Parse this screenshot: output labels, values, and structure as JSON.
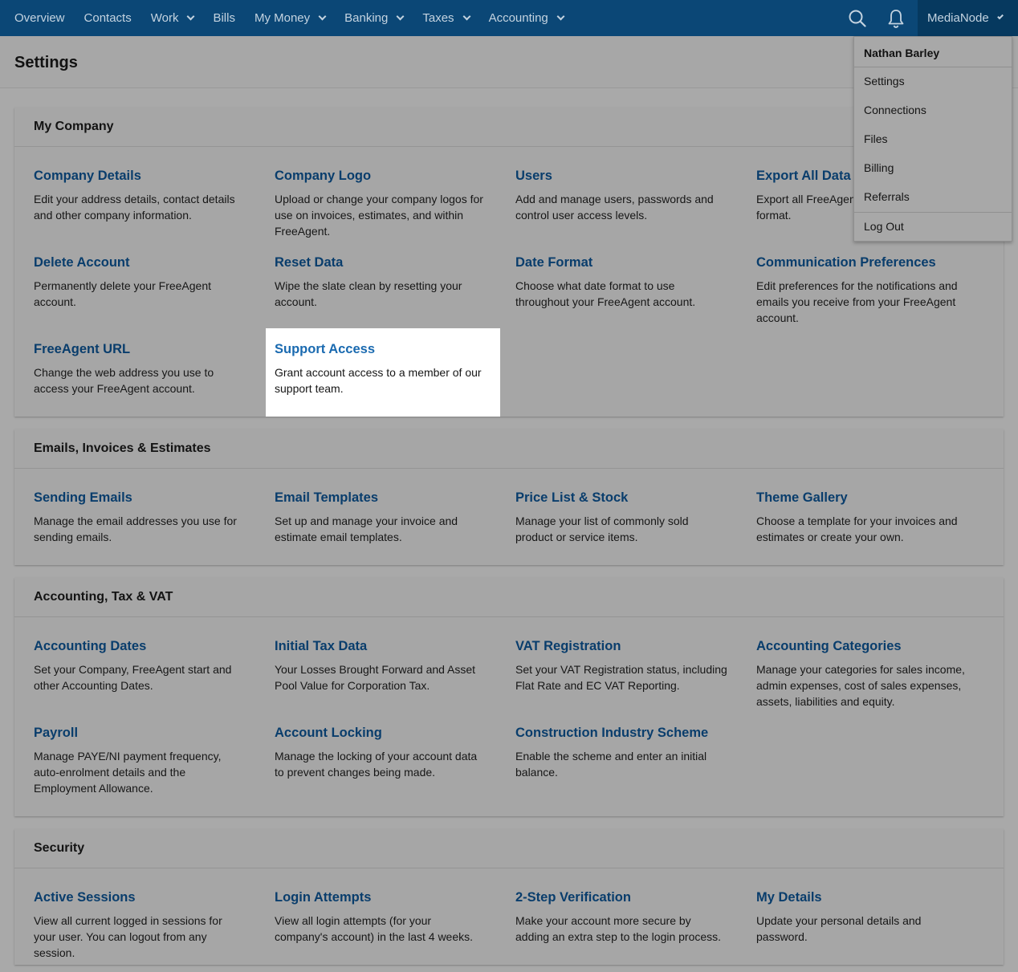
{
  "nav": {
    "items": [
      {
        "label": "Overview"
      },
      {
        "label": "Contacts"
      },
      {
        "label": "Work"
      },
      {
        "label": "Bills"
      },
      {
        "label": "My Money"
      },
      {
        "label": "Banking"
      },
      {
        "label": "Taxes"
      },
      {
        "label": "Accounting"
      }
    ],
    "account_label": "MediaNode",
    "icons": [
      "search-icon",
      "bell-icon",
      "chevron-down-icon"
    ]
  },
  "page": {
    "title": "Settings"
  },
  "dropdown": {
    "user_name": "Nathan Barley",
    "items": [
      "Settings",
      "Connections",
      "Files",
      "Billing",
      "Referrals"
    ],
    "logout": "Log Out"
  },
  "sections": [
    {
      "title": "My Company",
      "items": [
        {
          "title": "Company Details",
          "desc": "Edit your address details, contact details and other company information."
        },
        {
          "title": "Company Logo",
          "desc": "Upload or change your company logos for use on invoices, estimates, and within FreeAgent."
        },
        {
          "title": "Users",
          "desc": "Add and manage users, passwords and control user access levels."
        },
        {
          "title": "Export All Data",
          "desc": "Export all FreeAgent data in Excel (XLSX) format."
        },
        {
          "title": "Delete Account",
          "desc": "Permanently delete your FreeAgent account."
        },
        {
          "title": "Reset Data",
          "desc": "Wipe the slate clean by resetting your account."
        },
        {
          "title": "Date Format",
          "desc": "Choose what date format to use throughout your FreeAgent account."
        },
        {
          "title": "Communication Preferences",
          "desc": "Edit preferences for the notifications and emails you receive from your FreeAgent account."
        },
        {
          "title": "FreeAgent URL",
          "desc": "Change the web address you use to access your FreeAgent account."
        },
        {
          "title": "Support Access",
          "desc": "Grant account access to a member of our support team."
        }
      ]
    },
    {
      "title": "Emails, Invoices & Estimates",
      "items": [
        {
          "title": "Sending Emails",
          "desc": "Manage the email addresses you use for sending emails."
        },
        {
          "title": "Email Templates",
          "desc": "Set up and manage your invoice and estimate email templates."
        },
        {
          "title": "Price List & Stock",
          "desc": "Manage your list of commonly sold product or service items."
        },
        {
          "title": "Theme Gallery",
          "desc": "Choose a template for your invoices and estimates or create your own."
        }
      ]
    },
    {
      "title": "Accounting, Tax & VAT",
      "items": [
        {
          "title": "Accounting Dates",
          "desc": "Set your Company, FreeAgent start and other Accounting Dates."
        },
        {
          "title": "Initial Tax Data",
          "desc": "Your Losses Brought Forward and Asset Pool Value for Corporation Tax."
        },
        {
          "title": "VAT Registration",
          "desc": "Set your VAT Registration status, including Flat Rate and EC VAT Reporting."
        },
        {
          "title": "Accounting Categories",
          "desc": "Manage your categories for sales income, admin expenses, cost of sales expenses, assets, liabilities and equity."
        },
        {
          "title": "Payroll",
          "desc": "Manage PAYE/NI payment frequency, auto-enrolment details and the Employment Allowance."
        },
        {
          "title": "Account Locking",
          "desc": "Manage the locking of your account data to prevent changes being made."
        },
        {
          "title": "Construction Industry Scheme",
          "desc": "Enable the scheme and enter an initial balance."
        }
      ]
    },
    {
      "title": "Security",
      "items": [
        {
          "title": "Active Sessions",
          "desc": "View all current logged in sessions for your user. You can logout from any session."
        },
        {
          "title": "Login Attempts",
          "desc": "View all login attempts (for your company's account) in the last 4 weeks."
        },
        {
          "title": "2-Step Verification",
          "desc": "Make your account more secure by adding an extra step to the login process."
        },
        {
          "title": "My Details",
          "desc": "Update your personal details and password."
        }
      ]
    }
  ],
  "colors": {
    "nav_bg": "#0b4776",
    "link": "#093d6c",
    "highlight_link": "#1a6ab0",
    "overlay_bg": "#a9a9a9"
  }
}
